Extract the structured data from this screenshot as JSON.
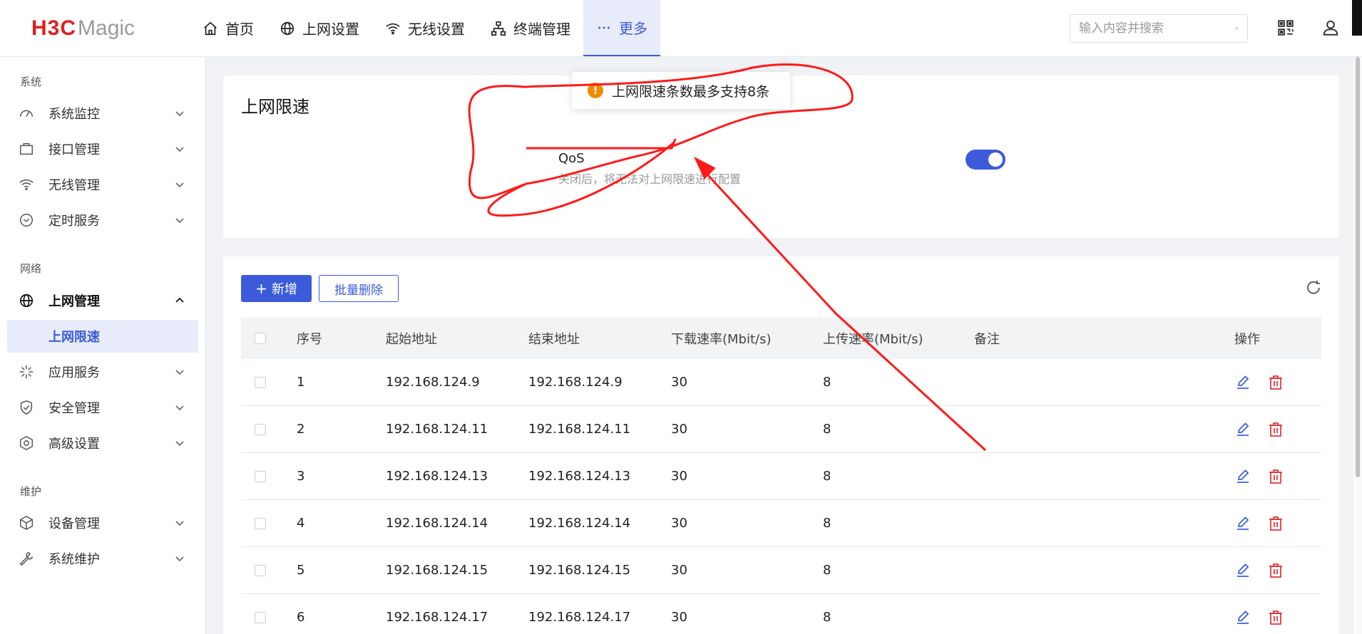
{
  "header": {
    "logo_red": "H3C",
    "logo_gray": "Magic",
    "nav": [
      {
        "label": "首页",
        "icon": "home-icon"
      },
      {
        "label": "上网设置",
        "icon": "globe-icon"
      },
      {
        "label": "无线设置",
        "icon": "wifi-icon"
      },
      {
        "label": "终端管理",
        "icon": "network-icon"
      },
      {
        "label": "更多",
        "icon": "more-icon",
        "active": true
      }
    ],
    "search_placeholder": "输入内容并搜索"
  },
  "sidebar": {
    "groups": [
      {
        "title": "系统",
        "items": [
          "系统监控",
          "接口管理",
          "无线管理",
          "定时服务"
        ]
      },
      {
        "title": "网络",
        "items": [
          "上网管理",
          "应用服务",
          "安全管理",
          "高级设置"
        ],
        "sub": "上网限速"
      },
      {
        "title": "维护",
        "items": [
          "设备管理",
          "系统维护"
        ]
      }
    ]
  },
  "qos_card": {
    "title": "上网限速",
    "qos_label": "QoS",
    "qos_desc": "关闭后，将无法对上网限速进行配置",
    "enabled": true
  },
  "toast": {
    "message": "上网限速条数最多支持8条"
  },
  "toolbar": {
    "add_label": "新增",
    "add_plus": "+",
    "batch_delete_label": "批量删除"
  },
  "table": {
    "columns": [
      "序号",
      "起始地址",
      "结束地址",
      "下载速率(Mbit/s)",
      "上传速率(Mbit/s)",
      "备注",
      "操作"
    ],
    "rows": [
      [
        "1",
        "192.168.124.9",
        "192.168.124.9",
        "30",
        "8",
        ""
      ],
      [
        "2",
        "192.168.124.11",
        "192.168.124.11",
        "30",
        "8",
        ""
      ],
      [
        "3",
        "192.168.124.13",
        "192.168.124.13",
        "30",
        "8",
        ""
      ],
      [
        "4",
        "192.168.124.14",
        "192.168.124.14",
        "30",
        "8",
        ""
      ],
      [
        "5",
        "192.168.124.15",
        "192.168.124.15",
        "30",
        "8",
        ""
      ],
      [
        "6",
        "192.168.124.17",
        "192.168.124.17",
        "30",
        "8",
        ""
      ]
    ]
  },
  "colors": {
    "accent": "#3b5bdb",
    "brand_red": "#e02020",
    "delete_red": "#e03131",
    "annotation_red": "#ff1a1a",
    "warning": "#f08c00"
  }
}
